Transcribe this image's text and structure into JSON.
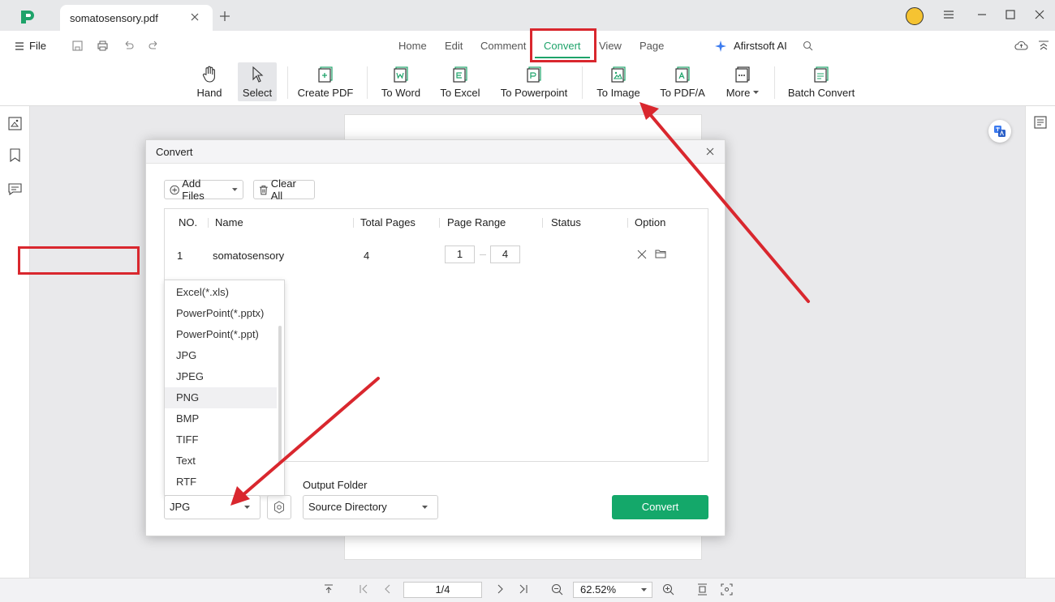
{
  "tabbar": {
    "document_tab": "somatosensory.pdf",
    "logo_icon": "pdfelement-logo-icon"
  },
  "menubar": {
    "file_label": "File",
    "tabs": [
      "Home",
      "Edit",
      "Comment",
      "Convert",
      "View",
      "Page"
    ],
    "active_tab": "Convert",
    "ai_label": "Afirstsoft AI"
  },
  "toolbar": {
    "items": [
      {
        "label": "Hand",
        "icon": "hand-icon"
      },
      {
        "label": "Select",
        "icon": "cursor-icon"
      },
      {
        "label": "Create PDF",
        "icon": "create-pdf-icon"
      },
      {
        "label": "To Word",
        "icon": "word-doc-icon"
      },
      {
        "label": "To Excel",
        "icon": "excel-doc-icon"
      },
      {
        "label": "To Powerpoint",
        "icon": "powerpoint-doc-icon"
      },
      {
        "label": "To Image",
        "icon": "image-doc-icon"
      },
      {
        "label": "To PDF/A",
        "icon": "pdfa-doc-icon"
      },
      {
        "label": "More",
        "icon": "more-doc-icon"
      },
      {
        "label": "Batch Convert",
        "icon": "batch-convert-icon"
      }
    ]
  },
  "dialog": {
    "title": "Convert",
    "add_files_label": "Add Files",
    "clear_all_label": "Clear All",
    "table": {
      "headers": [
        "NO.",
        "Name",
        "Total Pages",
        "Page Range",
        "Status",
        "Option"
      ],
      "rows": [
        {
          "no": "1",
          "name": "somatosensory",
          "total_pages": "4",
          "range_from": "1",
          "range_to": "4",
          "status": ""
        }
      ]
    },
    "format_options": [
      "Excel(*.xls)",
      "PowerPoint(*.pptx)",
      "PowerPoint(*.ppt)",
      "JPG",
      "JPEG",
      "PNG",
      "BMP",
      "TIFF",
      "Text",
      "RTF"
    ],
    "highlighted_option": "PNG",
    "format_selected": "JPG",
    "output_folder_label": "Output Folder",
    "output_folder_value": "Source Directory",
    "convert_button": "Convert"
  },
  "statusbar": {
    "page_indicator": "1/4",
    "zoom": "62.52%"
  },
  "colors": {
    "accent_green": "#14a86a",
    "annotation_red": "#d9272e"
  }
}
